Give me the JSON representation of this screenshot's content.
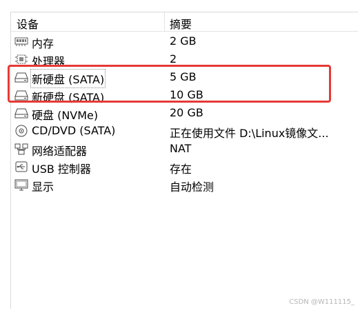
{
  "header": {
    "device_col": "设备",
    "summary_col": "摘要"
  },
  "devices": [
    {
      "name": "内存",
      "summary": "2 GB",
      "icon": "memory-icon"
    },
    {
      "name": "处理器",
      "summary": "2",
      "icon": "cpu-icon"
    },
    {
      "name": "新硬盘 (SATA)",
      "summary": "5 GB",
      "icon": "hard-disk-icon"
    },
    {
      "name": "新硬盘 (SATA)",
      "summary": "10 GB",
      "icon": "hard-disk-icon"
    },
    {
      "name": "硬盘 (NVMe)",
      "summary": "20 GB",
      "icon": "hard-disk-icon"
    },
    {
      "name": "CD/DVD (SATA)",
      "summary": "正在使用文件 D:\\Linux镜像文...",
      "icon": "cd-dvd-icon"
    },
    {
      "name": "网络适配器",
      "summary": "NAT",
      "icon": "network-adapter-icon"
    },
    {
      "name": "USB 控制器",
      "summary": "存在",
      "icon": "usb-icon"
    },
    {
      "name": "显示",
      "summary": "自动检测",
      "icon": "display-icon"
    }
  ],
  "watermark": "CSDN @W111115_",
  "colors": {
    "highlight": "#e53935",
    "border": "#d9d9d9"
  }
}
